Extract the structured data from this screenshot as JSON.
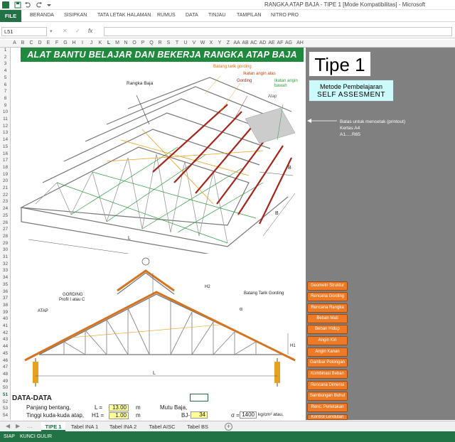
{
  "window": {
    "title": "RANGKA ATAP BAJA - TIPE 1  [Mode Kompatibilitas] - Microsoft"
  },
  "ribbon": {
    "file_label": "FILE",
    "tabs": [
      "BERANDA",
      "SISIPKAN",
      "TATA LETAK HALAMAN",
      "RUMUS",
      "DATA",
      "TINJAU",
      "TAMPILAN",
      "NITRO PRO"
    ]
  },
  "formula_bar": {
    "name_box": "L51",
    "formula": "",
    "fx_label": "fx"
  },
  "columns": [
    "A",
    "B",
    "C",
    "D",
    "E",
    "F",
    "G",
    "H",
    "I",
    "J",
    "K",
    "L",
    "M",
    "N",
    "O",
    "P",
    "Q",
    "R",
    "S",
    "T",
    "U",
    "V",
    "W",
    "X",
    "Y",
    "Z",
    "AA",
    "AB",
    "AC",
    "AD",
    "AE",
    "AF",
    "AG",
    "AH"
  ],
  "rows": [
    "1",
    "2",
    "3",
    "4",
    "5",
    "6",
    "7",
    "8",
    "9",
    "10",
    "11",
    "12",
    "13",
    "14",
    "15",
    "16",
    "17",
    "18",
    "19",
    "20",
    "21",
    "22",
    "23",
    "24",
    "25",
    "26",
    "27",
    "28",
    "29",
    "30",
    "31",
    "32",
    "33",
    "34",
    "35",
    "36",
    "37",
    "38",
    "39",
    "40",
    "41",
    "42",
    "43",
    "44",
    "45",
    "46",
    "47",
    "48",
    "49",
    "50",
    "51",
    "52",
    "53",
    "54"
  ],
  "sheet": {
    "banner": "ALAT BANTU BELAJAR DAN BEKERJA RANGKA ATAP BAJA",
    "tipe": "Tipe 1",
    "metode_line1": "Metode Pembelajaran",
    "metode_line2": "SELF  ASSESMENT",
    "batas": [
      "Batas untuk mencetak (printout)",
      "Kertas A4",
      "A1.....R65"
    ],
    "diagram1_labels": {
      "rangka": "Rangka Baja",
      "batang_tarik": "Batang tarik gording",
      "ikatan_atas": "Ikatan angin atas",
      "gording": "Gording",
      "ikatan_bawah": "Ikatan angin bawah",
      "atap": "Atap",
      "L": "L",
      "B1": "B",
      "B2": "B"
    },
    "diagram2_labels": {
      "gording": "GORDING",
      "profil": "Profil I atau C",
      "atap": "ATAP",
      "h2": "H2",
      "h1": "H1",
      "batang_tarik": "Batang Tarik Gording",
      "alpha": "α",
      "L": "L"
    },
    "data_title": "DATA-DATA",
    "data_rows": [
      {
        "label": "Panjang bentang,",
        "sym": "L =",
        "val": "13.00",
        "unit": "m"
      },
      {
        "label": "Tinggi kuda-kuda atap,",
        "sym": "H1 =",
        "val": "1.00",
        "unit": "m"
      },
      {
        "label": "Tinggi...",
        "sym": "H2 =",
        "val": "0.35",
        "unit": "m"
      }
    ],
    "mutu": {
      "label": "Mutu Baja,",
      "bj_label": "BJ-",
      "bj_val": "34",
      "sigma_label": "σ =",
      "sigma_val": "1400",
      "sigma_unit": "kg/cm² atau,",
      "fy_label": "fy =",
      "fy_unit": "kg/cm²"
    }
  },
  "buttons": [
    "Geometri Struktur",
    "Rencana Gording",
    "Rencana Rangka",
    "Beban Mati",
    "Beban Hidup",
    "Angin Kiri",
    "Angin Kanan",
    "Gambar Potongan",
    "Kombinasi Beban",
    "Rencana Dimensi",
    "Sambungan Buhul",
    "Renc. Perletakan",
    "Kontrol Lendutan"
  ],
  "sheet_tabs": [
    "TIPE 1",
    "Tabel INA 1",
    "Tabel INA 2",
    "Tabel AISC",
    "Tabel BS"
  ],
  "status": {
    "ready": "SIAP",
    "kunci": "KUNCI GULIR"
  },
  "colors": {
    "excel_green": "#217346",
    "banner_green": "#1f8a3e",
    "button_orange": "#ef7a26",
    "side_grey": "#808080",
    "input_yellow": "#ffff99"
  }
}
